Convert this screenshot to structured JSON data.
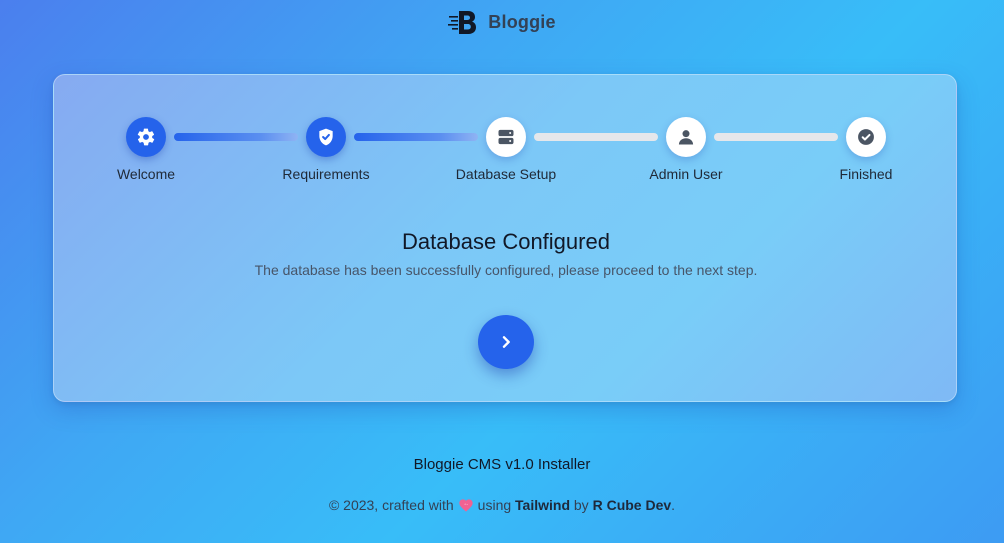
{
  "brand": {
    "name": "Bloggie"
  },
  "steps": [
    {
      "label": "Welcome",
      "icon": "gear-icon",
      "status": "done"
    },
    {
      "label": "Requirements",
      "icon": "shield-check-icon",
      "status": "done"
    },
    {
      "label": "Database Setup",
      "icon": "server-icon",
      "status": "current"
    },
    {
      "label": "Admin User",
      "icon": "user-icon",
      "status": "todo"
    },
    {
      "label": "Finished",
      "icon": "check-circle-icon",
      "status": "todo"
    }
  ],
  "main": {
    "title": "Database Configured",
    "subtitle": "The database has been successfully configured, please proceed to the next step.",
    "next_icon": "chevron-right-icon"
  },
  "footer": {
    "title": "Bloggie CMS v1.0 Installer",
    "prefix": "© 2023, crafted with",
    "heart_icon": "heart-icon",
    "using": "using",
    "tailwind": "Tailwind",
    "by": "by",
    "author": "R Cube Dev",
    "suffix": "."
  },
  "colors": {
    "accent": "#2563eb",
    "step_inactive": "#e5e7eb",
    "icon_inactive": "#4b5563"
  }
}
